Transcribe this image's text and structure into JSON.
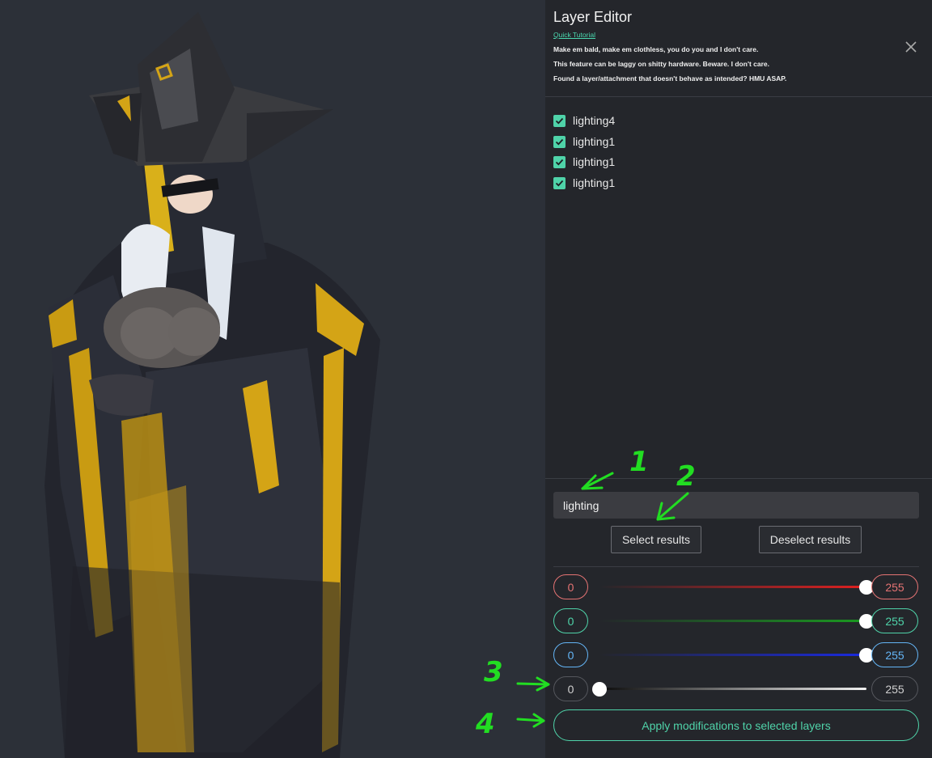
{
  "panel": {
    "title": "Layer Editor",
    "tutorial_link": "Quick Tutorial",
    "notes": [
      "Make em bald, make em clothless, you do you and I don't care.",
      "This feature can be laggy on shitty hardware. Beware. I don't care.",
      "Found a layer/attachment that doesn't behave as intended? HMU ASAP."
    ],
    "close_icon": "close-icon"
  },
  "layers": [
    {
      "label": "lighting4",
      "checked": true
    },
    {
      "label": "lighting1",
      "checked": true
    },
    {
      "label": "lighting1",
      "checked": true
    },
    {
      "label": "lighting1",
      "checked": true
    }
  ],
  "search": {
    "value": "lighting"
  },
  "buttons": {
    "select": "Select results",
    "deselect": "Deselect results"
  },
  "sliders": [
    {
      "channel": "red",
      "min_value": "0",
      "max_value": "255",
      "level": 1.0,
      "color": "#e53935"
    },
    {
      "channel": "green",
      "min_value": "0",
      "max_value": "255",
      "level": 1.0,
      "color": "#4fd3a9"
    },
    {
      "channel": "blue",
      "min_value": "0",
      "max_value": "255",
      "level": 1.0,
      "color": "#64b5f6"
    },
    {
      "channel": "alpha",
      "min_value": "0",
      "max_value": "255",
      "level": 0.0,
      "color": "#bdbdbd"
    }
  ],
  "apply_button": "Apply modifications to selected layers",
  "annotations": [
    "1",
    "2",
    "3",
    "4"
  ],
  "colors": {
    "accent": "#4fd3a9",
    "panel_bg": "#24262b",
    "canvas_bg": "#2c3038",
    "annotation": "#22dd22"
  }
}
